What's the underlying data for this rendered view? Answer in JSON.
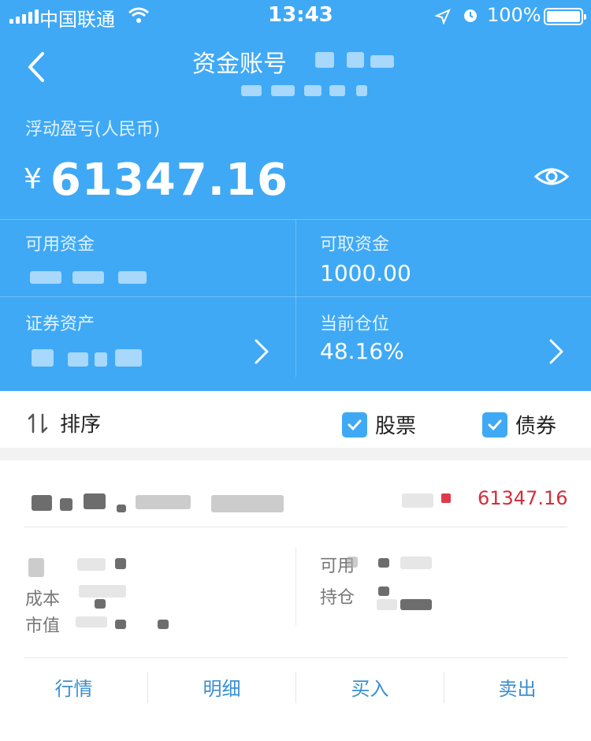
{
  "status_bar": {
    "carrier": "中国联通",
    "time": "13:43",
    "battery": "100%"
  },
  "nav": {
    "title": "资金账号",
    "back_icon": "chevron-left-icon"
  },
  "summary": {
    "floating_pl_label": "浮动盈亏(人民币)",
    "currency": "¥",
    "floating_pl_value": "61347.16",
    "eye_icon": "eye-icon"
  },
  "funds": {
    "available_label": "可用资金",
    "withdrawable_label": "可取资金",
    "withdrawable_value": "1000.00",
    "securities_label": "证券资产",
    "position_label": "当前仓位",
    "position_value": "48.16%"
  },
  "filter": {
    "sort_label": "排序",
    "stocks_label": "股票",
    "stocks_checked": true,
    "bonds_label": "债券",
    "bonds_checked": true
  },
  "holding": {
    "pl_value": "61347.16",
    "cost_label": "成本",
    "market_value_label": "市值",
    "available_label": "可用",
    "position_label": "持仓"
  },
  "actions": {
    "quote": "行情",
    "detail": "明细",
    "buy": "买入",
    "sell": "卖出"
  },
  "colors": {
    "header_blue": "#3fa9f5",
    "profit_red": "#d0303c",
    "action_blue": "#3a8fd0"
  }
}
